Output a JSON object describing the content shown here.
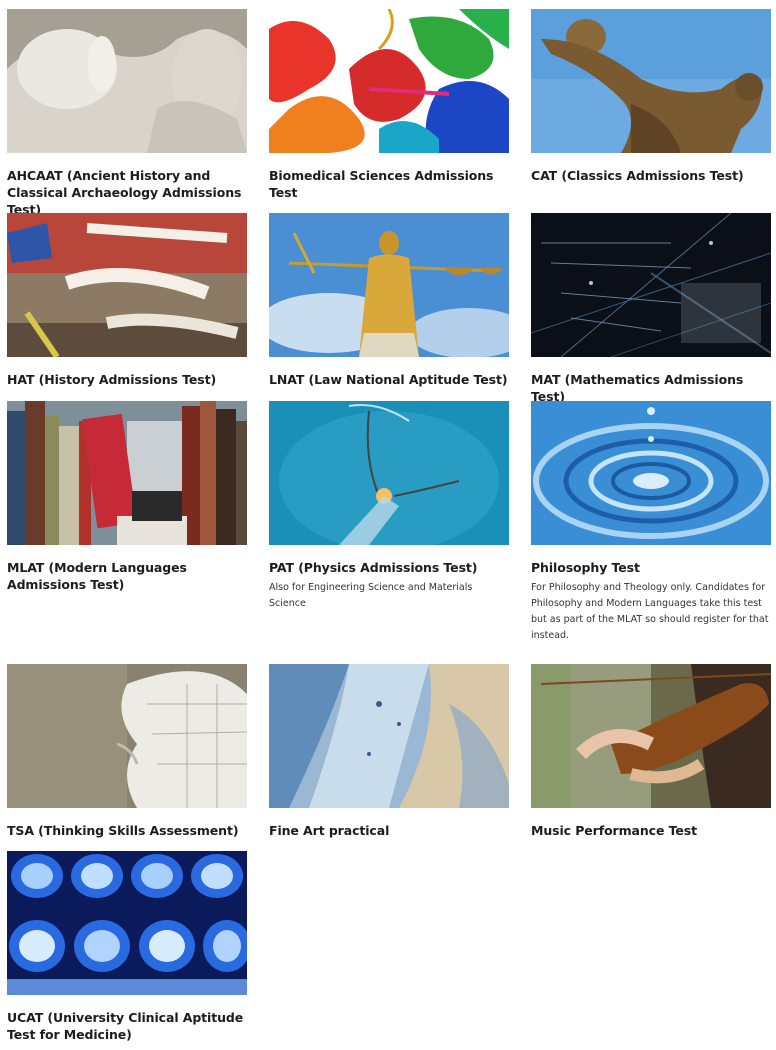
{
  "courses": [
    {
      "title": "AHCAAT (Ancient History and Classical Archaeology Admissions Test)",
      "description": "",
      "image": "classical-statue-image"
    },
    {
      "title": "Biomedical Sciences Admissions Test",
      "description": "",
      "image": "protein-ribbon-image"
    },
    {
      "title": "CAT (Classics Admissions Test)",
      "description": "",
      "image": "discus-thrower-image"
    },
    {
      "title": "HAT (History Admissions Test)",
      "description": "",
      "image": "berlin-graffiti-image"
    },
    {
      "title": "LNAT (Law National Aptitude Test)",
      "description": "",
      "image": "lady-justice-image"
    },
    {
      "title": "MAT (Mathematics Admissions Test)",
      "description": "",
      "image": "math-equations-image"
    },
    {
      "title": "MLAT (Modern Languages Admissions Test)",
      "description": "",
      "image": "books-shelf-image"
    },
    {
      "title": "PAT (Physics Admissions Test)",
      "description": "Also for Engineering Science and Materials Science",
      "image": "lightbulb-filament-image"
    },
    {
      "title": "Philosophy Test",
      "description": "For Philosophy and Theology only. Candidates for Philosophy and Modern Languages take this test but as part of the MLAT so should register for that instead.",
      "image": "water-ripple-image"
    },
    {
      "title": "TSA (Thinking Skills Assessment)",
      "description": "",
      "image": "phrenology-head-image"
    },
    {
      "title": "Fine Art practical",
      "description": "",
      "image": "abstract-paint-image"
    },
    {
      "title": "Music Performance Test",
      "description": "",
      "image": "violin-player-image"
    },
    {
      "title": "UCAT (University Clinical Aptitude Test for Medicine)",
      "description": "",
      "image": "brain-scan-image"
    }
  ]
}
